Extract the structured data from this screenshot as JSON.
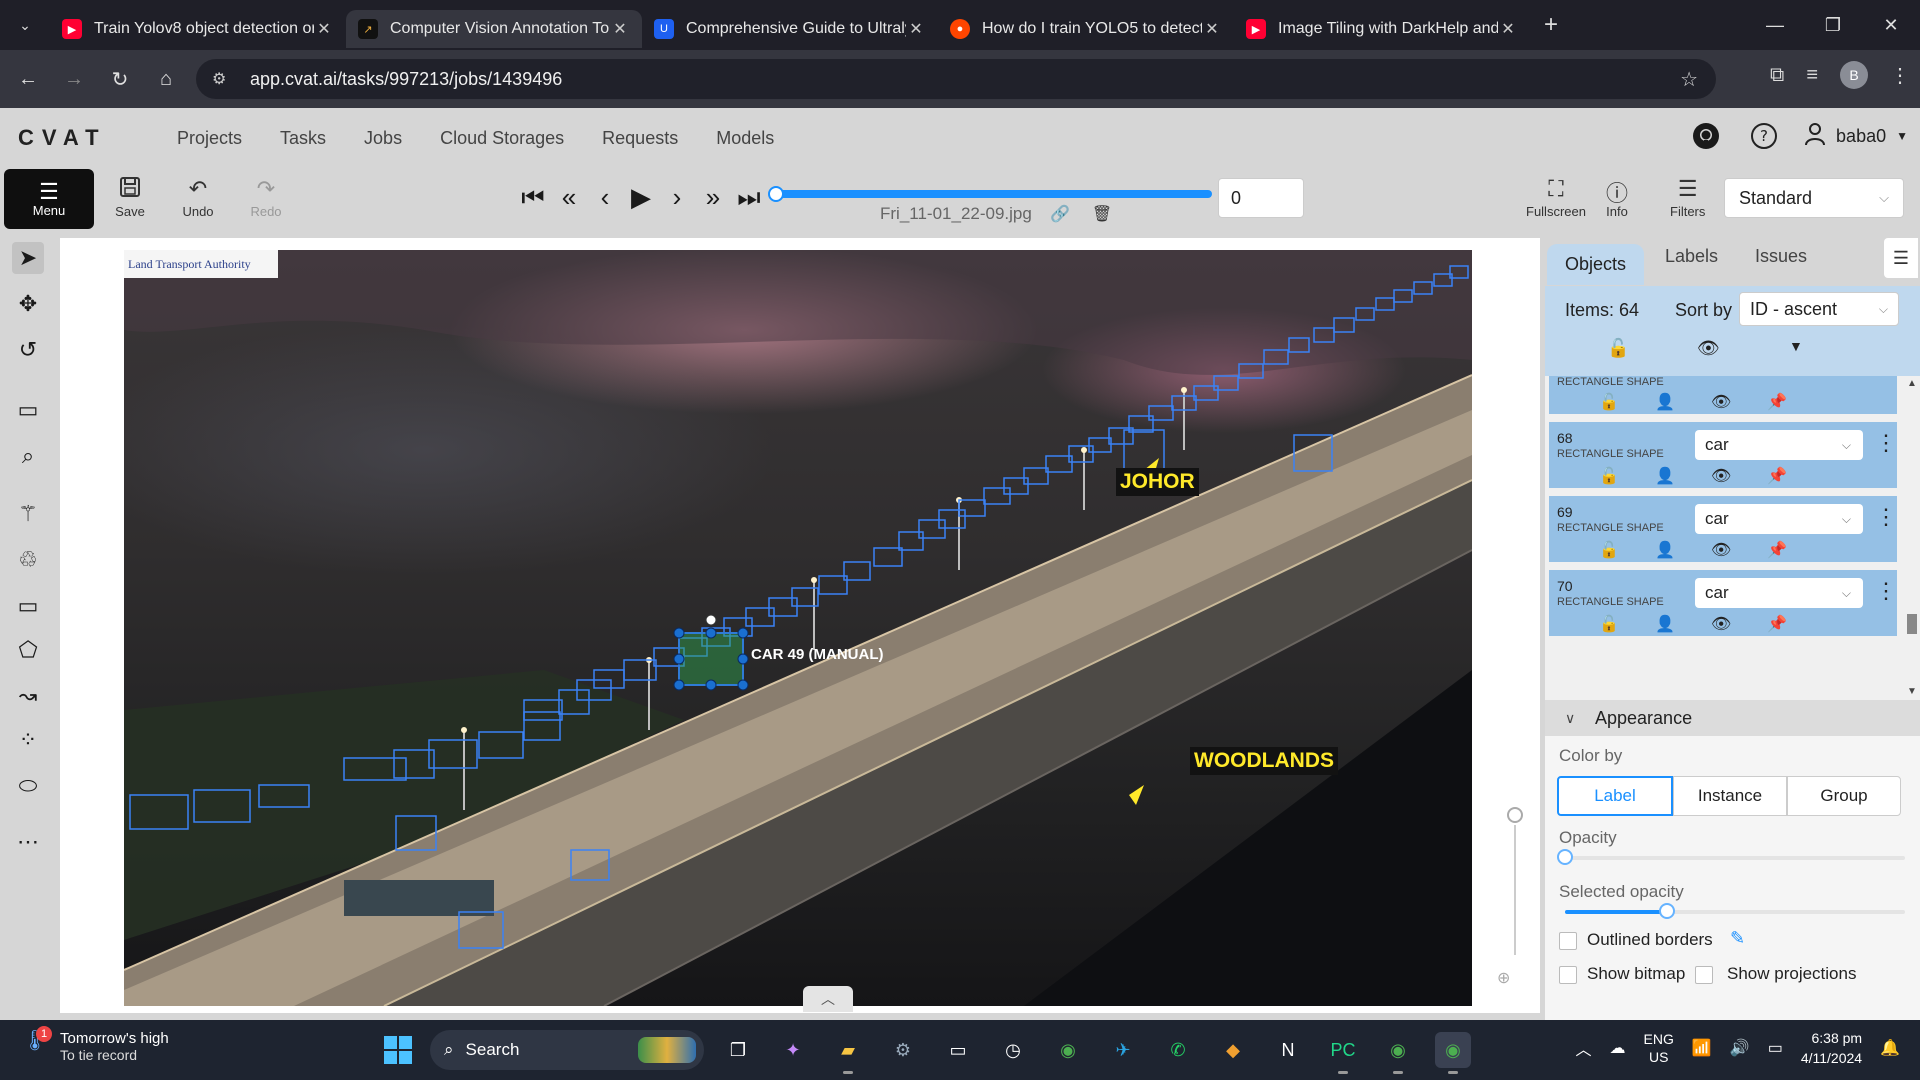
{
  "browser": {
    "tabs": [
      {
        "title": "Train Yolov8 object detection or",
        "favicon": "youtube-icon",
        "color": "#ff0033"
      },
      {
        "title": "Computer Vision Annotation To",
        "favicon": "cvat-icon",
        "color": "#111111",
        "active": true
      },
      {
        "title": "Comprehensive Guide to Ultraly",
        "favicon": "ultralytics-icon",
        "color": "#1e60f0"
      },
      {
        "title": "How do I train YOLO5 to detect",
        "favicon": "reddit-icon",
        "color": "#ff4500"
      },
      {
        "title": "Image Tiling with DarkHelp and",
        "favicon": "youtube-icon",
        "color": "#ff0033"
      }
    ],
    "url": "app.cvat.ai/tasks/997213/jobs/1439496",
    "profile_initial": "B"
  },
  "header": {
    "logo": "CVAT",
    "nav": [
      "Projects",
      "Tasks",
      "Jobs",
      "Cloud Storages",
      "Requests",
      "Models"
    ],
    "username": "baba0"
  },
  "toolbar": {
    "menu_label": "Menu",
    "save_label": "Save",
    "undo_label": "Undo",
    "redo_label": "Redo",
    "filename": "Fri_11-01_22-09.jpg",
    "frame_number": "0",
    "fullscreen_label": "Fullscreen",
    "info_label": "Info",
    "filters_label": "Filters",
    "workspace": "Standard"
  },
  "canvas": {
    "logo_text": "Land Transport Authority",
    "label_johor": "JOHOR",
    "label_woodlands": "WOODLANDS",
    "selected_label": "CAR 49 (MANUAL)",
    "box_color": "#3b82f6",
    "selected_color": "#2fa84f"
  },
  "sidebar": {
    "tabs": [
      "Objects",
      "Labels",
      "Issues"
    ],
    "items_count": "Items: 64",
    "sort_label": "Sort by",
    "sort_value": "ID - ascent",
    "objects": [
      {
        "id": "",
        "type": "RECTANGLE SHAPE",
        "label": ""
      },
      {
        "id": "68",
        "type": "RECTANGLE SHAPE",
        "label": "car"
      },
      {
        "id": "69",
        "type": "RECTANGLE SHAPE",
        "label": "car"
      },
      {
        "id": "70",
        "type": "RECTANGLE SHAPE",
        "label": "car"
      }
    ],
    "appearance": {
      "title": "Appearance",
      "color_by_label": "Color by",
      "color_by_options": [
        "Label",
        "Instance",
        "Group"
      ],
      "color_by_selected": "Label",
      "opacity_label": "Opacity",
      "opacity_value": 0,
      "selected_opacity_label": "Selected opacity",
      "selected_opacity_value": 0.3,
      "outlined_borders": "Outlined borders",
      "show_bitmap": "Show bitmap",
      "show_projections": "Show projections"
    }
  },
  "taskbar": {
    "weather_title": "Tomorrow's high",
    "weather_sub": "To tie record",
    "notification_count": "1",
    "search_placeholder": "Search",
    "lang_1": "ENG",
    "lang_2": "US",
    "time": "6:38 pm",
    "date": "4/11/2024"
  }
}
